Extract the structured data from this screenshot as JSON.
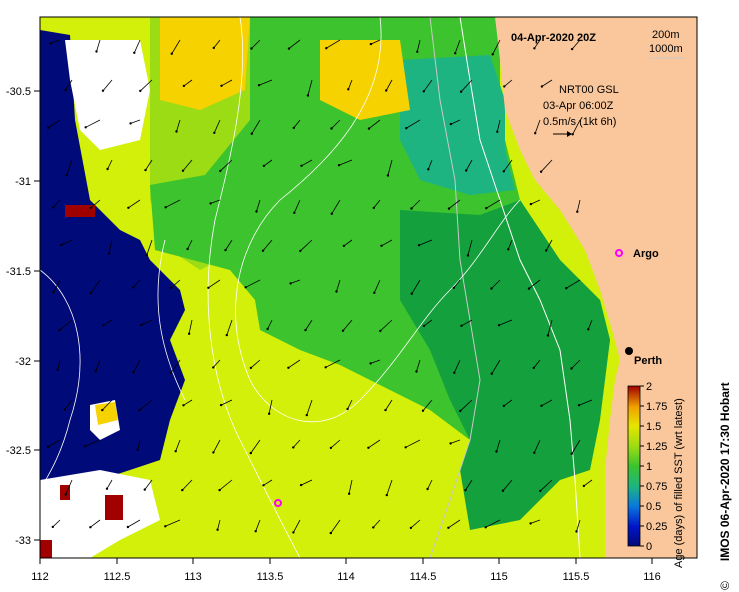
{
  "title_datetime": "04-Apr-2020 20Z",
  "isobath_legend": {
    "line1": "200m",
    "line2": "1000m"
  },
  "current_legend": {
    "source": "NRT00 GSL",
    "time": "03-Apr 06:00Z",
    "scale": "0.5m/s (1kt 6h)"
  },
  "places": [
    {
      "name": "Argo",
      "lon": 115.75,
      "lat": -31.45
    },
    {
      "name": "Perth",
      "lon": 115.86,
      "lat": -31.95
    }
  ],
  "argo_float_2": {
    "lon": 113.58,
    "lat": -32.79
  },
  "x_axis": {
    "ticks": [
      "112",
      "112.5",
      "113",
      "113.5",
      "114",
      "114.5",
      "115",
      "115.5",
      "116"
    ]
  },
  "y_axis": {
    "ticks": [
      "-30.5",
      "-31",
      "-31.5",
      "-32",
      "-32.5",
      "-33"
    ]
  },
  "colorbar": {
    "label": "Age (days) of filled SST (wrt latest)",
    "ticks": [
      "0",
      "0.25",
      "0.5",
      "0.75",
      "1",
      "1.25",
      "1.5",
      "1.75",
      "2"
    ],
    "range": [
      0,
      2
    ]
  },
  "credit": {
    "symbol": "©",
    "text": "IMOS 06-Apr-2020 17:30 Hobart"
  },
  "colors": {
    "land": "#f9c79b",
    "deep_blue": "#000a78",
    "yellow_green": "#d2f00a",
    "lime": "#9bdc14",
    "green": "#3cc32d",
    "dark_green": "#14a03c",
    "teal": "#1eb482",
    "yellow": "#f5d200",
    "marker": "#ff00ff"
  }
}
